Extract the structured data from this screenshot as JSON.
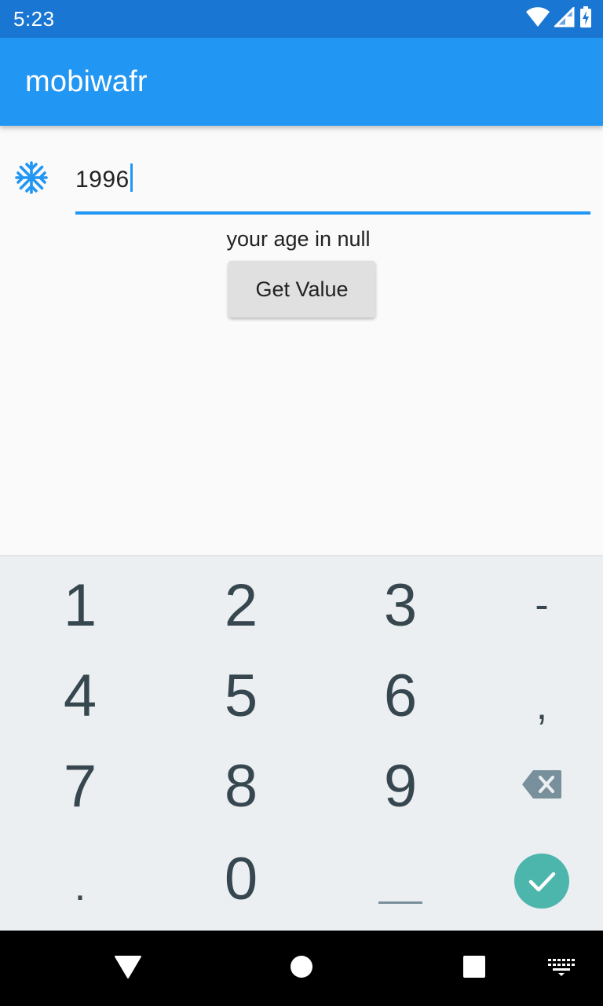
{
  "status_bar": {
    "time": "5:23",
    "icons": [
      "wifi-icon",
      "signal-icon",
      "battery-icon"
    ]
  },
  "app_bar": {
    "title": "mobiwafr"
  },
  "input": {
    "icon": "snowflake-icon",
    "value": "1996"
  },
  "result_text": "your age in null",
  "get_button_label": "Get Value",
  "keyboard": {
    "rows": [
      [
        "1",
        "2",
        "3",
        "-"
      ],
      [
        "4",
        "5",
        "6",
        ","
      ],
      [
        "7",
        "8",
        "9",
        "backspace"
      ],
      [
        ".",
        "0",
        "space",
        "done"
      ]
    ],
    "done_color": "#4db6ac"
  },
  "nav_bar": {
    "items": [
      "back",
      "home",
      "recents",
      "keyboard-switch"
    ]
  },
  "colors": {
    "primary": "#2196f3",
    "primary_dark": "#1976d2",
    "keyboard_bg": "#eceff1",
    "key_text": "#37474f"
  }
}
